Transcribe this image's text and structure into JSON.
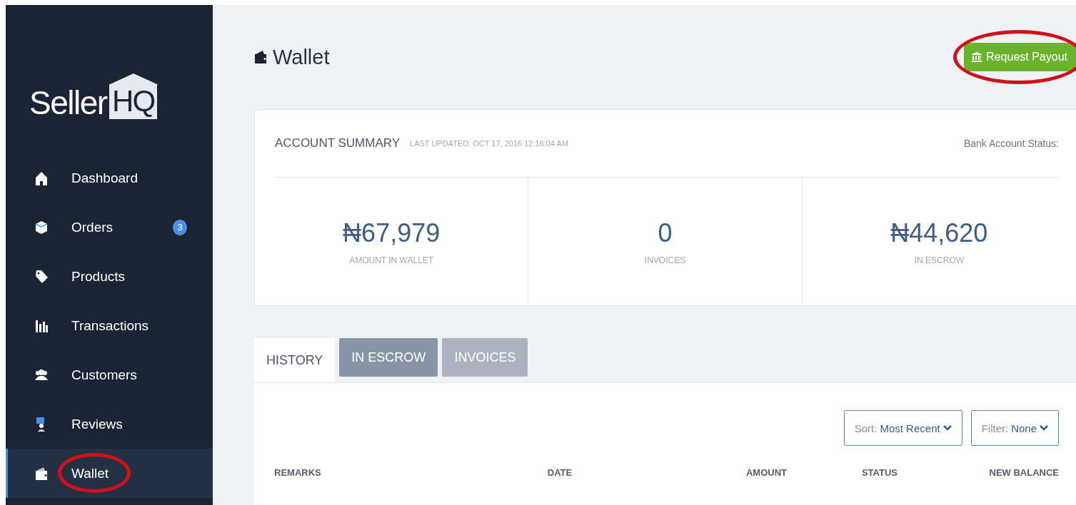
{
  "logo": {
    "text": "Seller",
    "boxed_text": "HQ"
  },
  "sidebar": {
    "items": [
      {
        "label": "Dashboard",
        "kind": "home",
        "selected": false,
        "circled": false
      },
      {
        "label": "Orders",
        "kind": "box",
        "selected": false,
        "circled": false,
        "badge": "3"
      },
      {
        "label": "Products",
        "kind": "tag",
        "selected": false,
        "circled": false
      },
      {
        "label": "Transactions",
        "kind": "bars",
        "selected": false,
        "circled": false
      },
      {
        "label": "Customers",
        "kind": "users",
        "selected": false,
        "circled": false
      },
      {
        "label": "Reviews",
        "kind": "review",
        "selected": false,
        "circled": false
      },
      {
        "label": "Wallet",
        "kind": "wallet",
        "selected": true,
        "circled": true
      }
    ]
  },
  "page": {
    "title": "Wallet",
    "action": {
      "label": "Request Payout",
      "circled": true
    }
  },
  "summary": {
    "title": "ACCOUNT SUMMARY",
    "updated": "LAST UPDATED: OCT 17, 2016 12:16:04 AM",
    "bank_status": "Bank Account Status:",
    "stats": [
      {
        "value": "₦67,979",
        "label": "AMOUNT IN WALLET"
      },
      {
        "value": "0",
        "label": "INVOICES"
      },
      {
        "value": "₦44,620",
        "label": "IN ESCROW"
      }
    ]
  },
  "tabs": [
    {
      "label": "HISTORY",
      "selected": true
    },
    {
      "label": "IN ESCROW",
      "selected": false
    },
    {
      "label": "INVOICES",
      "selected": false
    }
  ],
  "sort": {
    "label": "Sort:",
    "value": "Most Recent"
  },
  "filter": {
    "label": "Filter:",
    "value": "None"
  },
  "table": {
    "columns": [
      "REMARKS",
      "DATE",
      "AMOUNT",
      "STATUS",
      "NEW BALANCE"
    ]
  }
}
